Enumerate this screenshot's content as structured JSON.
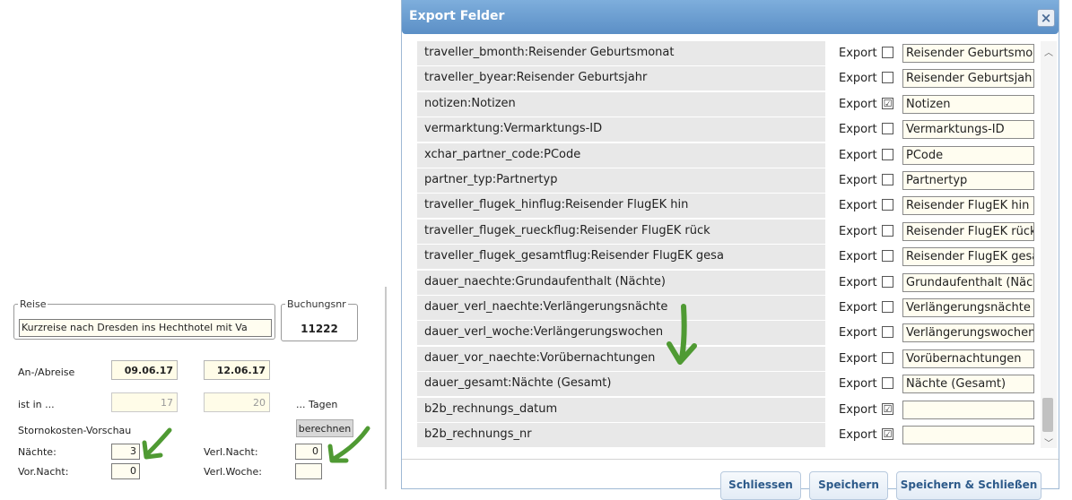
{
  "dialog": {
    "title": "Export Felder",
    "close_icon": "close-icon",
    "export_label": "Export",
    "rows": [
      {
        "field": "traveller_bmonth:Reisender Geburtsmonat",
        "checked": "",
        "value": "Reisender Geburtsmo"
      },
      {
        "field": "traveller_byear:Reisender Geburtsjahr",
        "checked": "",
        "value": "Reisender Geburtsjah"
      },
      {
        "field": "notizen:Notizen",
        "checked": "☑",
        "value": "Notizen"
      },
      {
        "field": "vermarktung:Vermarktungs-ID",
        "checked": "",
        "value": "Vermarktungs-ID"
      },
      {
        "field": "xchar_partner_code:PCode",
        "checked": "",
        "value": "PCode"
      },
      {
        "field": "partner_typ:Partnertyp",
        "checked": "",
        "value": "Partnertyp"
      },
      {
        "field": "traveller_flugek_hinflug:Reisender FlugEK hin",
        "checked": "",
        "value": "Reisender FlugEK hin"
      },
      {
        "field": "traveller_flugek_rueckflug:Reisender FlugEK rück",
        "checked": "",
        "value": "Reisender FlugEK rück"
      },
      {
        "field": "traveller_flugek_gesamtflug:Reisender FlugEK gesa",
        "checked": "",
        "value": "Reisender FlugEK gesa"
      },
      {
        "field": "dauer_naechte:Grundaufenthalt (Nächte)",
        "checked": "",
        "value": "Grundaufenthalt (Näc"
      },
      {
        "field": "dauer_verl_naechte:Verlängerungsnächte",
        "checked": "",
        "value": "Verlängerungsnächte"
      },
      {
        "field": "dauer_verl_woche:Verlängerungswochen",
        "checked": "",
        "value": "Verlängerungswochen"
      },
      {
        "field": "dauer_vor_naechte:Vorübernachtungen",
        "checked": "",
        "value": "Vorübernachtungen"
      },
      {
        "field": "dauer_gesamt:Nächte (Gesamt)",
        "checked": "",
        "value": "Nächte (Gesamt)"
      },
      {
        "field": "b2b_rechnungs_datum",
        "checked": "☑",
        "value": ""
      },
      {
        "field": "b2b_rechnungs_nr",
        "checked": "☑",
        "value": ""
      }
    ],
    "buttons": {
      "close": "Schliessen",
      "save": "Speichern",
      "save_close": "Speichern & Schließen"
    },
    "scroll_up_icon": "chevron-up-icon",
    "scroll_down_icon": "chevron-down-icon"
  },
  "form": {
    "reise_legend": "Reise",
    "reise_value": "Kurzreise nach Dresden ins Hechthotel mit Va",
    "buchungsnr_legend": "Buchungsnr",
    "buchungsnr_value": "11222",
    "an_abreise_label": "An-/Abreise",
    "anreise": "09.06.17",
    "abreise": "12.06.17",
    "ist_in_label": "ist in ...",
    "ist_in_1": "17",
    "ist_in_2": "20",
    "tagen_label": "... Tagen",
    "storno_label": "Stornokosten-Vorschau",
    "berechnen": "berechnen",
    "naechte_label": "Nächte:",
    "naechte": "3",
    "verl_nacht_label": "Verl.Nacht:",
    "verl_nacht": "0",
    "vor_nacht_label": "Vor.Nacht:",
    "vor_nacht": "0",
    "verl_woche_label": "Verl.Woche:",
    "verl_woche": ""
  },
  "annotations": {
    "arrow_color": "#4f9a33"
  }
}
